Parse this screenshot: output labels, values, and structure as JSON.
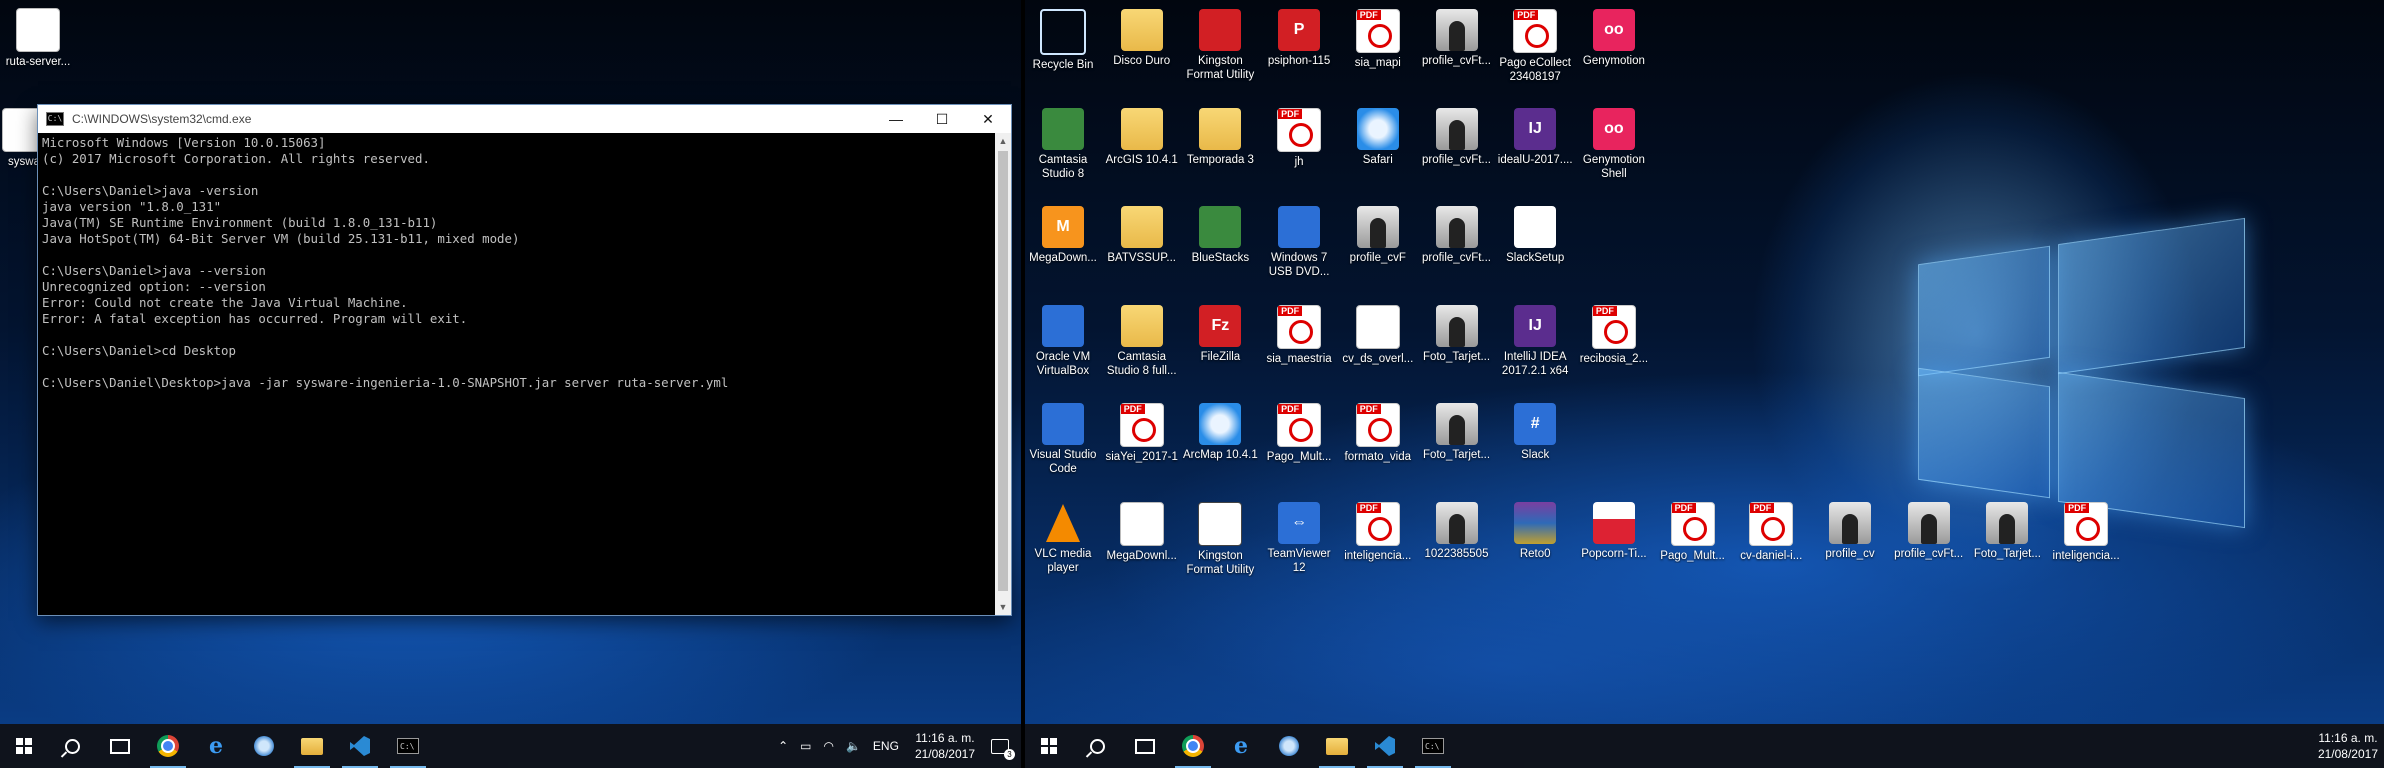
{
  "left_monitor": {
    "desktop_icons": [
      {
        "label": "ruta-server...",
        "kind": "doc"
      },
      {
        "label": "syswa",
        "kind": "doc"
      }
    ],
    "cmd": {
      "title": "C:\\WINDOWS\\system32\\cmd.exe",
      "minimize": "—",
      "maximize": "☐",
      "close": "✕",
      "lines": [
        "Microsoft Windows [Version 10.0.15063]",
        "(c) 2017 Microsoft Corporation. All rights reserved.",
        "",
        "C:\\Users\\Daniel>java -version",
        "java version \"1.8.0_131\"",
        "Java(TM) SE Runtime Environment (build 1.8.0_131-b11)",
        "Java HotSpot(TM) 64-Bit Server VM (build 25.131-b11, mixed mode)",
        "",
        "C:\\Users\\Daniel>java --version",
        "Unrecognized option: --version",
        "Error: Could not create the Java Virtual Machine.",
        "Error: A fatal exception has occurred. Program will exit.",
        "",
        "C:\\Users\\Daniel>cd Desktop",
        "",
        "C:\\Users\\Daniel\\Desktop>java -jar sysware-ingenieria-1.0-SNAPSHOT.jar server ruta-server.yml"
      ]
    },
    "taskbar": {
      "lang": "ENG",
      "time": "11:16 a. m.",
      "date": "21/08/2017",
      "notifications": "3"
    }
  },
  "right_monitor": {
    "desktop_icons": [
      {
        "label": "Recycle Bin",
        "kind": "recycle",
        "col": 0,
        "row": 0
      },
      {
        "label": "Disco Duro",
        "kind": "folder",
        "col": 1,
        "row": 0
      },
      {
        "label": "Kingston Format Utility",
        "kind": "red",
        "col": 2,
        "row": 0
      },
      {
        "label": "psiphon-115",
        "kind": "red",
        "glyph": "P",
        "col": 3,
        "row": 0
      },
      {
        "label": "sia_mapi",
        "kind": "pdf",
        "col": 4,
        "row": 0
      },
      {
        "label": "profile_cvFt...",
        "kind": "photo",
        "col": 5,
        "row": 0
      },
      {
        "label": "Pago eCollect 23408197",
        "kind": "pdf",
        "col": 6,
        "row": 0
      },
      {
        "label": "Genymotion",
        "kind": "pink",
        "glyph": "oo",
        "col": 7,
        "row": 0
      },
      {
        "label": "Camtasia Studio 8",
        "kind": "green",
        "col": 0,
        "row": 1
      },
      {
        "label": "ArcGIS 10.4.1",
        "kind": "folder",
        "col": 1,
        "row": 1
      },
      {
        "label": "Temporada 3",
        "kind": "folder",
        "col": 2,
        "row": 1
      },
      {
        "label": "jh",
        "kind": "pdf",
        "col": 3,
        "row": 1
      },
      {
        "label": "Safari",
        "kind": "safari",
        "col": 4,
        "row": 1
      },
      {
        "label": "profile_cvFt...",
        "kind": "photo",
        "col": 5,
        "row": 1
      },
      {
        "label": "idealU-2017....",
        "kind": "purple",
        "glyph": "IJ",
        "col": 6,
        "row": 1
      },
      {
        "label": "Genymotion Shell",
        "kind": "pink",
        "glyph": "oo",
        "col": 7,
        "row": 1
      },
      {
        "label": "MegaDown...",
        "kind": "orange",
        "glyph": "M",
        "col": 0,
        "row": 2
      },
      {
        "label": "BATVSSUP...",
        "kind": "folder",
        "col": 1,
        "row": 2
      },
      {
        "label": "BlueStacks",
        "kind": "green",
        "col": 2,
        "row": 2
      },
      {
        "label": "Windows 7 USB DVD...",
        "kind": "blue",
        "col": 3,
        "row": 2
      },
      {
        "label": "profile_cvF",
        "kind": "photo",
        "col": 4,
        "row": 2
      },
      {
        "label": "profile_cvFt...",
        "kind": "photo",
        "col": 5,
        "row": 2
      },
      {
        "label": "SlackSetup",
        "kind": "slack",
        "glyph": "S",
        "col": 6,
        "row": 2
      },
      {
        "label": "Oracle VM VirtualBox",
        "kind": "blue",
        "col": 0,
        "row": 3
      },
      {
        "label": "Camtasia Studio 8 full...",
        "kind": "folder",
        "col": 1,
        "row": 3
      },
      {
        "label": "FileZilla",
        "kind": "red",
        "glyph": "Fz",
        "col": 2,
        "row": 3
      },
      {
        "label": "sia_maestria",
        "kind": "pdf",
        "col": 3,
        "row": 3
      },
      {
        "label": "cv_ds_overl...",
        "kind": "doc",
        "col": 4,
        "row": 3
      },
      {
        "label": "Foto_Tarjet...",
        "kind": "photo",
        "col": 5,
        "row": 3
      },
      {
        "label": "IntelliJ IDEA 2017.2.1 x64",
        "kind": "purple",
        "glyph": "IJ",
        "col": 6,
        "row": 3
      },
      {
        "label": "recibosia_2...",
        "kind": "pdf",
        "col": 7,
        "row": 3
      },
      {
        "label": "Visual Studio Code",
        "kind": "blue",
        "col": 0,
        "row": 4
      },
      {
        "label": "siaYei_2017-1",
        "kind": "pdf",
        "col": 1,
        "row": 4
      },
      {
        "label": "ArcMap 10.4.1",
        "kind": "safari",
        "col": 2,
        "row": 4
      },
      {
        "label": "Pago_Mult...",
        "kind": "pdf",
        "col": 3,
        "row": 4
      },
      {
        "label": "formato_vida",
        "kind": "pdf",
        "col": 4,
        "row": 4
      },
      {
        "label": "Foto_Tarjet...",
        "kind": "photo",
        "col": 5,
        "row": 4
      },
      {
        "label": "Slack",
        "kind": "blue",
        "glyph": "#",
        "col": 6,
        "row": 4
      },
      {
        "label": "VLC media player",
        "kind": "vlc",
        "col": 0,
        "row": 5
      },
      {
        "label": "MegaDownl...",
        "kind": "doc",
        "col": 1,
        "row": 5
      },
      {
        "label": "Kingston Format Utility",
        "kind": "zip",
        "glyph": "7z",
        "col": 2,
        "row": 5
      },
      {
        "label": "TeamViewer 12",
        "kind": "blue",
        "glyph": "⇔",
        "col": 3,
        "row": 5
      },
      {
        "label": "inteligencia...",
        "kind": "pdf",
        "col": 4,
        "row": 5
      },
      {
        "label": "1022385505",
        "kind": "photo",
        "col": 5,
        "row": 5
      },
      {
        "label": "Reto0",
        "kind": "rar",
        "col": 6,
        "row": 5
      },
      {
        "label": "Popcorn-Ti...",
        "kind": "popcorn",
        "col": 7,
        "row": 5
      },
      {
        "label": "Pago_Mult...",
        "kind": "pdf",
        "col": 8,
        "row": 5
      },
      {
        "label": "cv-daniel-i...",
        "kind": "pdf",
        "col": 9,
        "row": 5
      },
      {
        "label": "profile_cv",
        "kind": "photo",
        "col": 10,
        "row": 5
      },
      {
        "label": "profile_cvFt...",
        "kind": "photo",
        "col": 11,
        "row": 5
      },
      {
        "label": "Foto_Tarjet...",
        "kind": "photo",
        "col": 12,
        "row": 5
      },
      {
        "label": "inteligencia...",
        "kind": "pdf",
        "col": 13,
        "row": 5
      }
    ],
    "taskbar": {
      "time": "11:16 a. m.",
      "date": "21/08/2017"
    }
  },
  "icons": {
    "start": "windows-start-icon",
    "search": "search-icon",
    "taskview": "task-view-icon",
    "chrome": "chrome-icon",
    "edge": "edge-icon",
    "cortana": "cortana-icon",
    "explorer": "file-explorer-icon",
    "vscode": "vscode-icon",
    "cmd": "command-prompt-icon"
  }
}
